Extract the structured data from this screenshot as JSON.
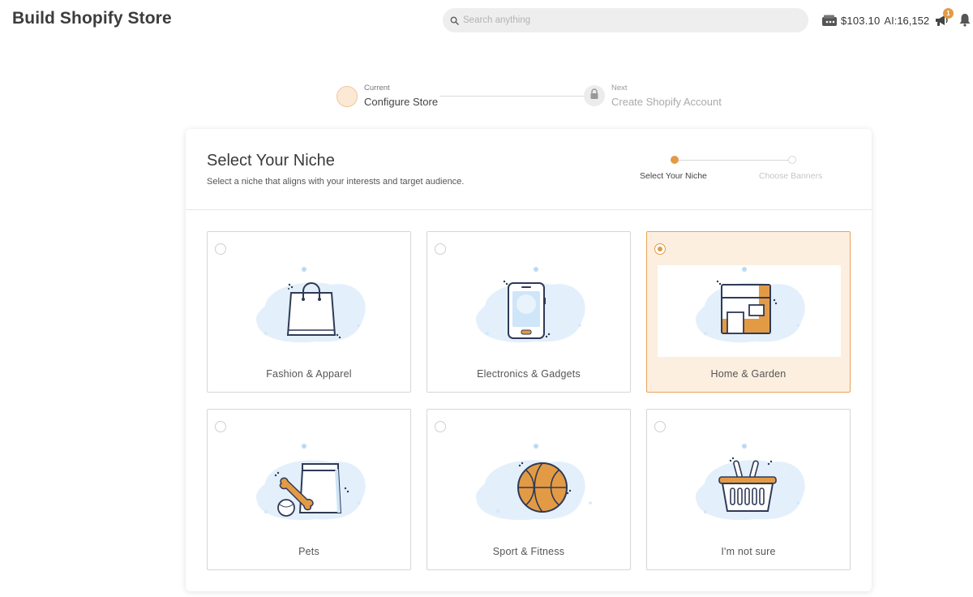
{
  "header": {
    "title": "Build Shopify Store",
    "search_placeholder": "Search anything",
    "balance": "$103.10",
    "ai_label": "AI:",
    "ai_credits": "16,152",
    "notification_count": "1"
  },
  "stepper": {
    "current_caption": "Current",
    "current_label": "Configure Store",
    "next_caption": "Next",
    "next_label": "Create Shopify Account"
  },
  "niche_card": {
    "title": "Select Your Niche",
    "subtitle": "Select a niche that aligns with your interests and target audience.",
    "substeps": [
      "Select Your Niche",
      "Choose Banners"
    ]
  },
  "niches": [
    {
      "label": "Fashion & Apparel",
      "icon": "shopping-bag-icon",
      "selected": false
    },
    {
      "label": "Electronics & Gadgets",
      "icon": "smartphone-icon",
      "selected": false
    },
    {
      "label": "Home & Garden",
      "icon": "house-icon",
      "selected": true
    },
    {
      "label": "Pets",
      "icon": "pet-food-icon",
      "selected": false
    },
    {
      "label": "Sport & Fitness",
      "icon": "basketball-icon",
      "selected": false
    },
    {
      "label": "I'm not sure",
      "icon": "basket-icon",
      "selected": false
    }
  ],
  "colors": {
    "accent": "#e39a45",
    "selected_bg": "#fcefe0",
    "illustration_blob": "#e3f0fb",
    "illustration_stroke": "#2f3a56"
  }
}
